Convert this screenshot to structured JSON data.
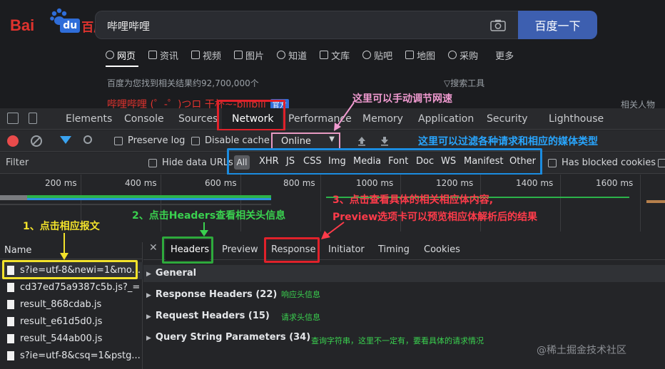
{
  "baidu": {
    "logo_left": "Bai",
    "logo_du": "du",
    "logo_right": "百度",
    "query": "哔哩哔哩",
    "search_button": "百度一下",
    "nav": [
      {
        "label": "网页",
        "active": true
      },
      {
        "label": "资讯",
        "active": false
      },
      {
        "label": "视频",
        "active": false
      },
      {
        "label": "图片",
        "active": false
      },
      {
        "label": "知道",
        "active": false
      },
      {
        "label": "文库",
        "active": false
      },
      {
        "label": "贴吧",
        "active": false
      },
      {
        "label": "地图",
        "active": false
      },
      {
        "label": "采购",
        "active": false
      },
      {
        "label": "更多",
        "active": false
      }
    ],
    "result_count": "百度为您找到相关结果约92,700,000个",
    "search_tools": "▽搜索工具",
    "first_result": "哔哩哔哩 (゜-゜)つロ 干杯~-bilibili",
    "official_badge": "官方",
    "related": "相关人物"
  },
  "devtools": {
    "tabs": [
      "Elements",
      "Console",
      "Sources",
      "Network",
      "Performance",
      "Memory",
      "Application",
      "Security",
      "Lighthouse"
    ],
    "selected_tab": "Network",
    "toolbar": {
      "preserve_log": "Preserve log",
      "disable_cache": "Disable cache",
      "throttle_value": "Online"
    },
    "filterbar": {
      "filter_placeholder": "Filter",
      "hide_data_urls": "Hide data URLs",
      "types": [
        "All",
        "XHR",
        "JS",
        "CSS",
        "Img",
        "Media",
        "Font",
        "Doc",
        "WS",
        "Manifest",
        "Other"
      ],
      "has_blocked_cookies": "Has blocked cookies"
    },
    "timeline_ticks": [
      "200 ms",
      "400 ms",
      "600 ms",
      "800 ms",
      "1000 ms",
      "1200 ms",
      "1400 ms",
      "1600 ms"
    ],
    "list_header": "Name",
    "requests": [
      "s?ie=utf-8&newi=1&mo...",
      "cd37ed75a9387c5b.js?_=...",
      "result_868cdab.js",
      "result_e61d5d0.js",
      "result_544ab00.js",
      "s?ie=utf-8&csq=1&pstg..."
    ],
    "detail_tabs": [
      "Headers",
      "Preview",
      "Response",
      "Initiator",
      "Timing",
      "Cookies"
    ],
    "sections": [
      {
        "label": "General"
      },
      {
        "label": "Response Headers (22)",
        "note": "响应头信息"
      },
      {
        "label": "Request Headers (15)",
        "note": "请求头信息"
      },
      {
        "label": "Query String Parameters (34)",
        "note": "查询字符串，这里不一定有，要看具体的请求情况"
      }
    ]
  },
  "annotations": {
    "throttle": "这里可以手动调节网速",
    "types": "这里可以过滤各种请求和相应的媒体类型",
    "step1": "1、点击相应报文",
    "step2": "2、点击Headers查看相关头信息",
    "step3_line1": "3、点击查看具体的相关相应体内容,",
    "step3_line2": "Preview选项卡可以预览相应体解析后的结果"
  },
  "watermark": "@稀土掘金技术社区",
  "colors": {
    "red_box": "#e0212a",
    "yellow_box": "#f2e22b",
    "green_box": "#2eaa3c",
    "blue_box": "#1b8ce0",
    "pink_box": "#e89ac3",
    "baidu_red": "#e0332e",
    "baidu_blue": "#3d5fb0"
  }
}
